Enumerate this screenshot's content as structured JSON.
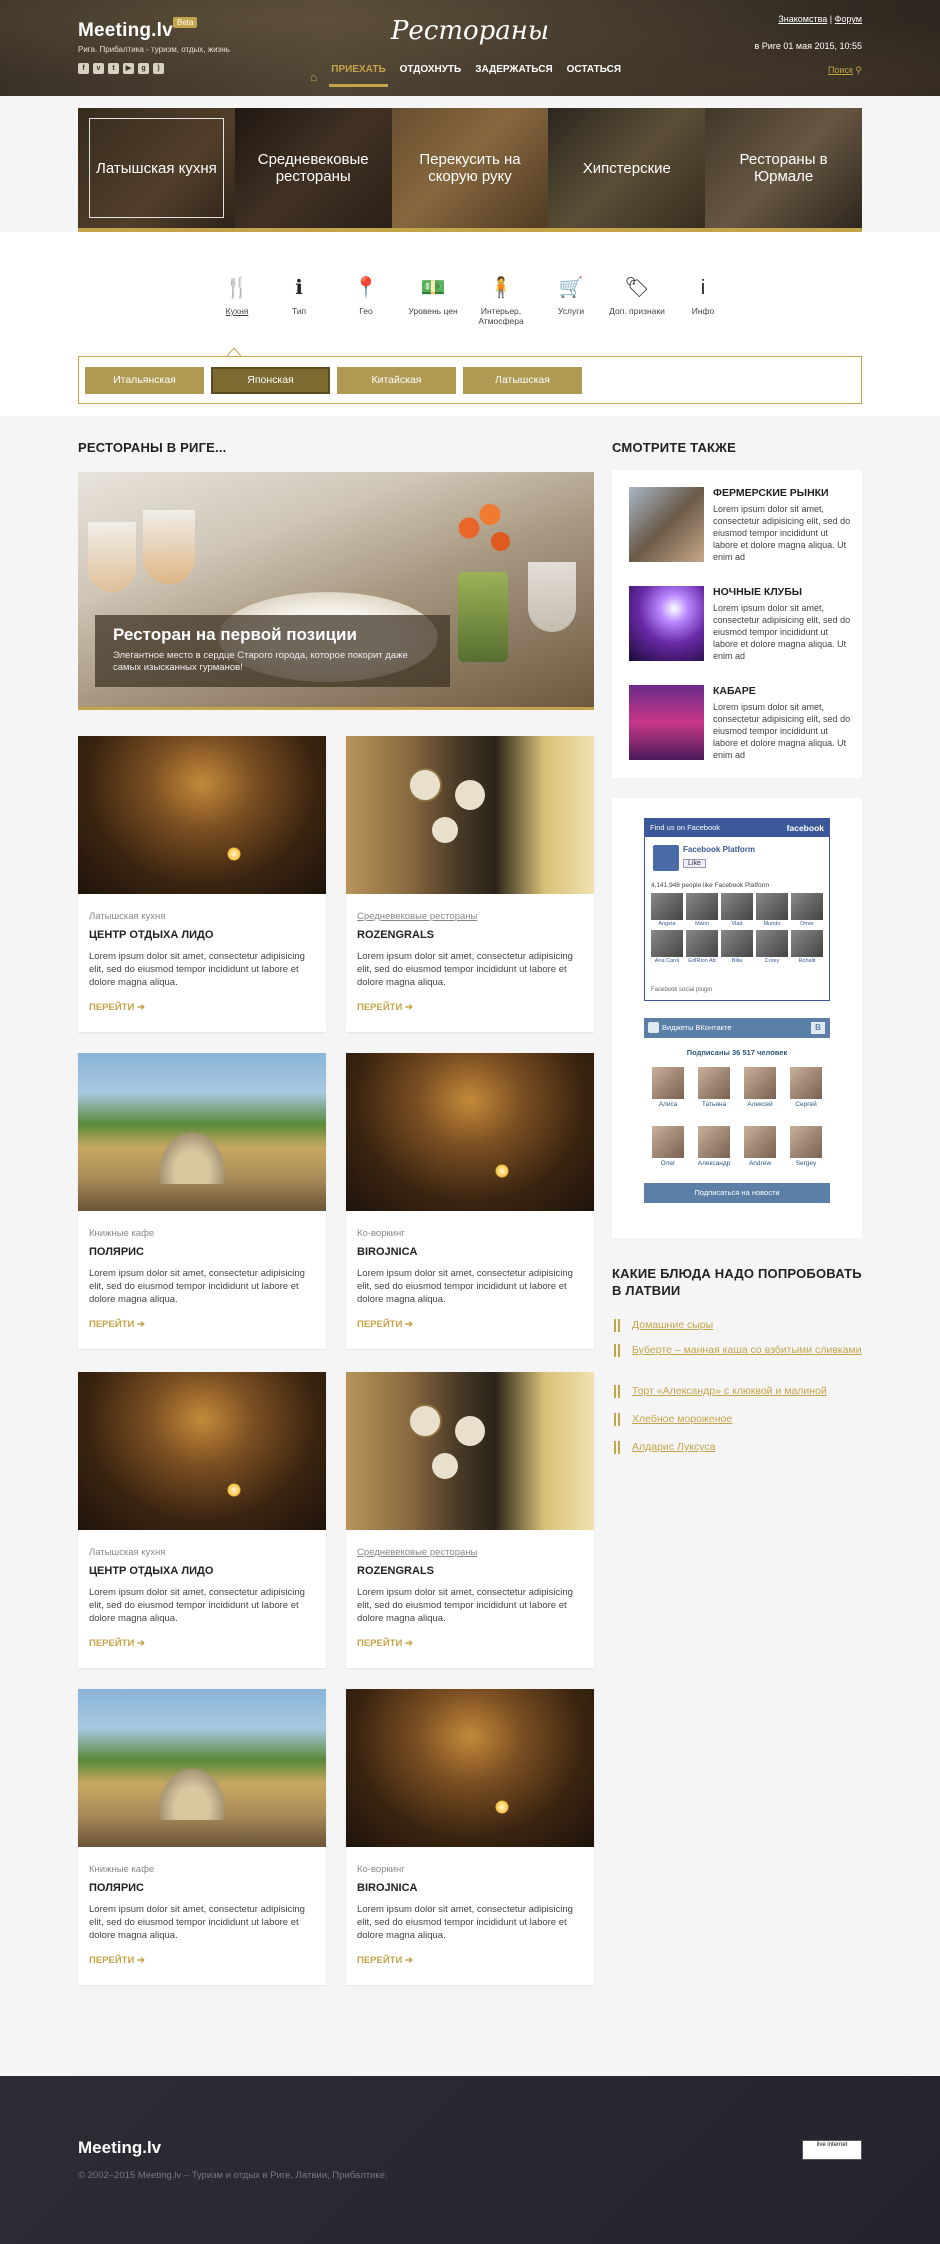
{
  "header": {
    "logo": "Meeting.lv",
    "badge": "Beta",
    "tagline": "Рига. Прибалтика - туризм, отдых, жизнь",
    "title": "Рестораны",
    "links": [
      "Знакомства",
      "Форум"
    ],
    "link_sep": "|",
    "datetime": "в Риге 01 мая 2015, 10:55",
    "search": "Поиск",
    "nav": [
      "ПРИЕХАТЬ",
      "ОТДОХНУТЬ",
      "ЗАДЕРЖАТЬСЯ",
      "ОСТАТЬСЯ"
    ],
    "nav_active": "ПРИЕХАТЬ",
    "socials": [
      "f",
      "vk",
      "t",
      "yt",
      "g",
      "rss"
    ]
  },
  "categories": [
    "Латышская кухня",
    "Средневековые рестораны",
    "Перекусить на скорую руку",
    "Хипстерские",
    "Рестораны в Юрмале"
  ],
  "filters": [
    {
      "icon": "🍴",
      "label": "Кухня"
    },
    {
      "icon": "ℹ",
      "label": "Тип"
    },
    {
      "icon": "📍",
      "label": "Гео"
    },
    {
      "icon": "💵",
      "label": "Уровень цен"
    },
    {
      "icon": "🧍",
      "label": "Интерьер, Атмосфера"
    },
    {
      "icon": "🛒",
      "label": "Услуги"
    },
    {
      "icon": "🏷",
      "label": "Доп. признаки"
    },
    {
      "icon": "i",
      "label": "Инфо"
    }
  ],
  "subtabs": [
    "Итальянская",
    "Японская",
    "Китайская",
    "Латышская"
  ],
  "subtab_active": "Японская",
  "main": {
    "section_title": "РЕСТОРАНЫ В РИГЕ...",
    "hero": {
      "title": "Ресторан на первой позиции",
      "text": "Элегантное место в сердце Старого города, которое покорит даже самых изысканных гурманов!"
    },
    "more_label": "ПЕРЕЙТИ",
    "cards": [
      {
        "meta": "Латышская кухня",
        "name": "ЦЕНТР ОТДЫХА ЛИДО",
        "desc": "Lorem ipsum dolor sit amet, consectetur adipisicing elit, sed do eiusmod tempor incididunt ut labore et dolore magna aliqua.",
        "img": "dark",
        "meta_link": false
      },
      {
        "meta": "Средневековые рестораны",
        "name": "ROZENGRALS",
        "desc": "Lorem ipsum dolor sit amet, consectetur adipisicing elit, sed do eiusmod tempor incididunt ut labore et dolore magna aliqua.",
        "img": "clock",
        "meta_link": true
      },
      {
        "meta": "Книжные кафе",
        "name": "ПОЛЯРИС",
        "desc": "Lorem ipsum dolor sit amet, consectetur adipisicing elit, sed do eiusmod tempor incididunt ut labore et dolore magna aliqua.",
        "img": "garden",
        "meta_link": false
      },
      {
        "meta": "Ко-воркинг",
        "name": "BIROJNICA",
        "desc": "Lorem ipsum dolor sit amet, consectetur adipisicing elit, sed do eiusmod tempor incididunt ut labore et dolore magna aliqua.",
        "img": "dark",
        "meta_link": false
      },
      {
        "meta": "Латышская кухня",
        "name": "ЦЕНТР ОТДЫХА ЛИДО",
        "desc": "Lorem ipsum dolor sit amet, consectetur adipisicing elit, sed do eiusmod tempor incididunt ut labore et dolore magna aliqua.",
        "img": "dark",
        "meta_link": false
      },
      {
        "meta": "Средневековые рестораны",
        "name": "ROZENGRALS",
        "desc": "Lorem ipsum dolor sit amet, consectetur adipisicing elit, sed do eiusmod tempor incididunt ut labore et dolore magna aliqua.",
        "img": "clock",
        "meta_link": true
      },
      {
        "meta": "Книжные кафе",
        "name": "ПОЛЯРИС",
        "desc": "Lorem ipsum dolor sit amet, consectetur adipisicing elit, sed do eiusmod tempor incididunt ut labore et dolore magna aliqua.",
        "img": "garden",
        "meta_link": false
      },
      {
        "meta": "Ко-воркинг",
        "name": "BIROJNICA",
        "desc": "Lorem ipsum dolor sit amet, consectetur adipisicing elit, sed do eiusmod tempor incididunt ut labore et dolore magna aliqua.",
        "img": "dark",
        "meta_link": false
      }
    ]
  },
  "sidebar": {
    "see_also_title": "СМОТРИТЕ ТАКЖЕ",
    "see_also": [
      {
        "title": "ФЕРМЕРСКИЕ РЫНКИ",
        "desc": "Lorem ipsum dolor sit amet, consectetur adipisicing elit, sed do eiusmod tempor incididunt ut labore et dolore magna aliqua. Ut enim ad"
      },
      {
        "title": "НОЧНЫЕ КЛУБЫ",
        "desc": "Lorem ipsum dolor sit amet, consectetur adipisicing elit, sed do eiusmod tempor incididunt ut labore et dolore magna aliqua. Ut enim ad"
      },
      {
        "title": "КАБАРЕ",
        "desc": "Lorem ipsum dolor sit amet, consectetur adipisicing elit, sed do eiusmod tempor incididunt ut labore et dolore magna aliqua. Ut enim ad"
      }
    ],
    "facebook": {
      "head": "Find us on Facebook",
      "brand": "facebook",
      "page": "Facebook Platform",
      "like": "Like",
      "count": "4,141,948 people like Facebook Platform",
      "faces": [
        "Angela",
        "Mann",
        "Vlad",
        "Mundo",
        "Omer",
        "Ana Carol",
        "EdIRion Att",
        "Bilia",
        "Corey",
        "Rohalit"
      ],
      "foot": "Facebook social plugin"
    },
    "vk": {
      "head": "Виджеты ВКонтакте",
      "logo": "B",
      "subs": "Подписаны 36 517 человек",
      "faces": [
        "Алиса",
        "Татьяна",
        "Алексей",
        "Сергей",
        "Олег",
        "Александр",
        "Andrew",
        "Sergey"
      ],
      "button": "Подписаться на новости"
    },
    "dishes_title": "КАКИЕ БЛЮДА НАДО ПОПРОБОВАТЬ В ЛАТВИИ",
    "dishes": [
      "Домашние сыры",
      "Буберте – манная каша со взбитыми сливками",
      "Торт «Александр» с клюквой и малиной",
      "Хлебное мороженое",
      "Алдарис Луксуса"
    ]
  },
  "footer": {
    "logo": "Meeting.lv",
    "copy": "© 2002–2015 Meeting.lv – Туризм и отдых в Риге, Латвии, Прибалтике.",
    "counter": "live internet"
  },
  "colors": {
    "accent": "#c4a44a",
    "dark": "#2c2c34"
  }
}
